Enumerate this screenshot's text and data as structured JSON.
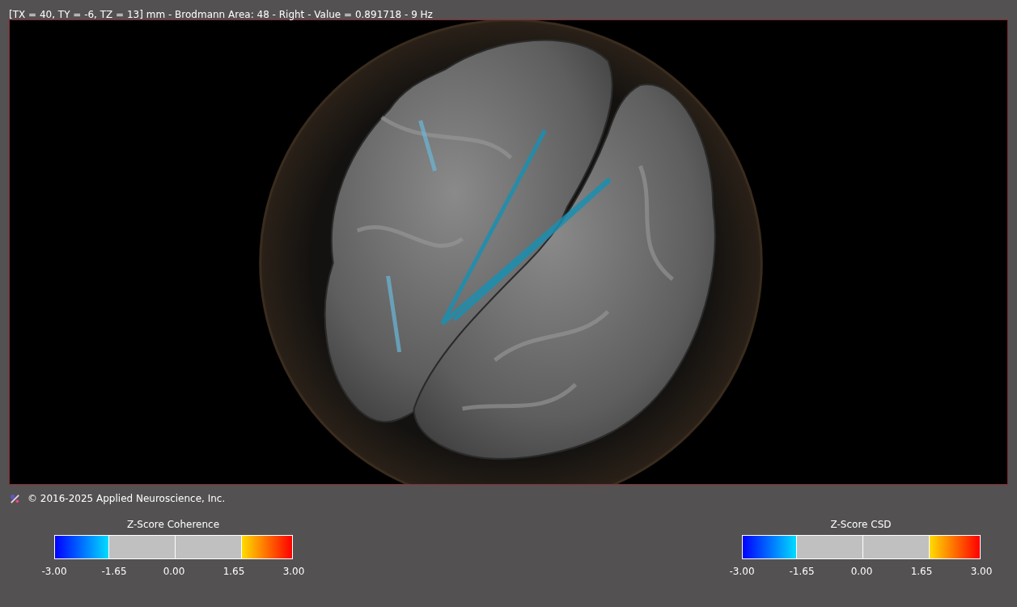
{
  "header": {
    "text": "[TX = 40, TY = -6, TZ = 13] mm - Brodmann Area: 48 - Right - Value = 0.891718 - 9 Hz"
  },
  "footer": {
    "copyright": "© 2016-2025 Applied Neuroscience, Inc."
  },
  "colorbars": [
    {
      "title": "Z-Score Coherence",
      "ticks": [
        "-3.00",
        "-1.65",
        "0.00",
        "1.65",
        "3.00"
      ]
    },
    {
      "title": "Z-Score CSD",
      "ticks": [
        "-3.00",
        "-1.65",
        "0.00",
        "1.65",
        "3.00"
      ]
    }
  ]
}
